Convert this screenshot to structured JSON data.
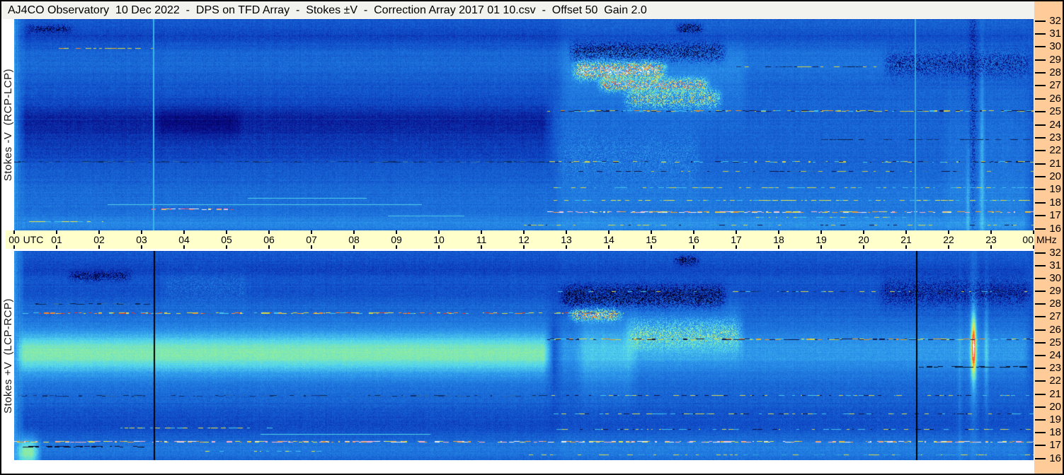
{
  "header": {
    "title": "AJ4CO Observatory  10 Dec 2022  -  DPS on TFD Array  -  Stokes ±V  -  Correction Array 2017 01 10.csv  -  Offset 50  Gain 2.0"
  },
  "axes": {
    "freq_unit": "MHz",
    "time_label": "UTC",
    "freq_ticks": [
      32,
      31,
      30,
      29,
      28,
      27,
      26,
      25,
      24,
      23,
      22,
      21,
      20,
      19,
      18,
      17,
      16
    ],
    "time_ticks": [
      {
        "label": "00",
        "t": 0
      },
      {
        "label": "UTC",
        "t": 0.45
      },
      {
        "label": "01",
        "t": 1
      },
      {
        "label": "02",
        "t": 2
      },
      {
        "label": "03",
        "t": 3
      },
      {
        "label": "04",
        "t": 4
      },
      {
        "label": "05",
        "t": 5
      },
      {
        "label": "06",
        "t": 6
      },
      {
        "label": "07",
        "t": 7
      },
      {
        "label": "08",
        "t": 8
      },
      {
        "label": "09",
        "t": 9
      },
      {
        "label": "10",
        "t": 10
      },
      {
        "label": "11",
        "t": 11
      },
      {
        "label": "12",
        "t": 12
      },
      {
        "label": "13",
        "t": 13
      },
      {
        "label": "14",
        "t": 14
      },
      {
        "label": "15",
        "t": 15
      },
      {
        "label": "16",
        "t": 16
      },
      {
        "label": "17",
        "t": 17
      },
      {
        "label": "18",
        "t": 18
      },
      {
        "label": "19",
        "t": 19
      },
      {
        "label": "20",
        "t": 20
      },
      {
        "label": "21",
        "t": 21
      },
      {
        "label": "22",
        "t": 22
      },
      {
        "label": "23",
        "t": 23
      },
      {
        "label": "00",
        "t": 24,
        "align": "right"
      }
    ]
  },
  "colors": {
    "time_band_bg": "#ffffcc",
    "freq_band_bg": "#ffcc99",
    "titlebar_bg": "#f2f2ee",
    "margin_bg": "#ffffff",
    "border": "#000000"
  },
  "chart_data": {
    "type": "heatmap",
    "title": "AJ4CO Observatory  10 Dec 2022  -  DPS on TFD Array  -  Stokes ±V  -  Correction Array 2017 01 10.csv  -  Offset 50  Gain 2.0",
    "observatory": "AJ4CO Observatory",
    "date": "10 Dec 2022",
    "instrument": "DPS on TFD Array",
    "quantity": "Stokes ±V",
    "correction_array": "Correction Array 2017 01 10.csv",
    "offset": 50,
    "gain": 2.0,
    "x_axis": {
      "label": "UTC",
      "range_hours": [
        0,
        24
      ],
      "tick_step": 1
    },
    "y_axis": {
      "label": "MHz",
      "range_mhz": [
        16,
        32
      ],
      "tick_step": 1
    },
    "colormap": [
      [
        0.0,
        0,
        0,
        40
      ],
      [
        0.08,
        8,
        8,
        130
      ],
      [
        0.18,
        14,
        70,
        195
      ],
      [
        0.25,
        25,
        105,
        215
      ],
      [
        0.35,
        45,
        150,
        235
      ],
      [
        0.47,
        85,
        215,
        235
      ],
      [
        0.6,
        150,
        240,
        150
      ],
      [
        0.7,
        235,
        235,
        85
      ],
      [
        0.8,
        255,
        165,
        45
      ],
      [
        0.9,
        255,
        60,
        40
      ],
      [
        1.0,
        255,
        255,
        255
      ]
    ],
    "panels": [
      {
        "ylabel": "Stokes -V  (RCP-LCP)",
        "seed": 7,
        "base": 0.215,
        "noise": 0.06,
        "bands": [
          {
            "f": 30.7,
            "s": 0.45,
            "a": -0.04,
            "t0": 0,
            "t1": 24
          },
          {
            "f": 29.0,
            "s": 0.9,
            "a": 0.035,
            "t0": 0,
            "t1": 24
          },
          {
            "f": 24.1,
            "s": 1.15,
            "a": -0.09,
            "t0": 0,
            "t1": 12.7
          },
          {
            "f": 24.2,
            "s": 0.85,
            "a": -0.045,
            "t0": 3.3,
            "t1": 5.4
          },
          {
            "f": 21.9,
            "s": 0.6,
            "a": -0.03,
            "t0": 0,
            "t1": 12.7
          },
          {
            "f": 17.9,
            "s": 1.3,
            "a": 0.05,
            "t0": 0,
            "t1": 24
          },
          {
            "f": 16.35,
            "s": 0.45,
            "a": 0.08,
            "t0": 0,
            "t1": 24
          },
          {
            "f": 24.0,
            "s": 15,
            "a": 0.025,
            "t0": 12.7,
            "t1": 24
          },
          {
            "f": 27.6,
            "s": 1.9,
            "a": 0.05,
            "t0": 12.8,
            "t1": 17.3
          },
          {
            "f": 21.0,
            "s": 3.2,
            "a": 0.03,
            "t0": 21.8,
            "t1": 24
          }
        ],
        "events": [
          {
            "f": 28.2,
            "s": 0.45,
            "a": 0.55,
            "t0": 13.1,
            "t1": 15.4,
            "sp": 1
          },
          {
            "f": 27.1,
            "s": 0.35,
            "a": 0.45,
            "t0": 13.7,
            "t1": 16.4,
            "sp": 1
          },
          {
            "f": 26.0,
            "s": 0.5,
            "a": 0.33,
            "t0": 14.3,
            "t1": 16.7,
            "sp": 1
          },
          {
            "f": 29.6,
            "s": 0.5,
            "a": -0.24,
            "t0": 13.0,
            "t1": 16.8,
            "sp": 1
          },
          {
            "f": 31.45,
            "s": 0.22,
            "a": -0.33,
            "t0": 15.55,
            "t1": 16.25,
            "sp": 1
          },
          {
            "f": 28.7,
            "s": 0.7,
            "a": -0.16,
            "t0": 20.4,
            "t1": 24,
            "sp": 1
          },
          {
            "f": 31.4,
            "s": 0.2,
            "a": -0.18,
            "t0": 0.2,
            "t1": 1.4,
            "sp": 1
          },
          {
            "f": 21.5,
            "s": 1.6,
            "a": 0.07,
            "t0": 12.7,
            "t1": 16.2,
            "sp": 1
          }
        ],
        "vstreaks": [
          {
            "t": 22.57,
            "f": 26,
            "fs": 9,
            "a": -0.13,
            "w": 3.5,
            "sp": 1
          },
          {
            "t": 22.78,
            "f": 21,
            "fs": 6,
            "a": 0.12,
            "w": 2.3,
            "sp": 0
          },
          {
            "t": 22.45,
            "f": 18,
            "fs": 3,
            "a": 0.1,
            "w": 1.8,
            "sp": 0
          }
        ],
        "vlines": [
          {
            "t": 3.283,
            "color": "#37b6e8",
            "w": 2
          },
          {
            "t": 21.22,
            "color": "#35a6de",
            "w": 2
          }
        ],
        "lines": [
          {
            "f": 29.9,
            "t0": 1.05,
            "t1": 3.27,
            "type": "speckle",
            "pal": [
              "#e8e44a",
              "#f0b020",
              "#d8d840",
              "#ff8820"
            ],
            "d": 0.85,
            "th": 1
          },
          {
            "f": 25.1,
            "t0": 12.55,
            "t1": 24,
            "type": "speckle",
            "pal": [
              "#d8d84a",
              "#0e0e3c",
              "#40c8f0",
              "#e89020",
              "#1a1a4a",
              "#c8c840"
            ],
            "d": 0.92,
            "th": 2
          },
          {
            "f": 21.2,
            "t0": 0,
            "t1": 12.6,
            "type": "speckle",
            "pal": [
              "#0a2a66",
              "#123a88",
              "#2a6ab0"
            ],
            "d": 0.75,
            "th": 2
          },
          {
            "f": 21.2,
            "t0": 12.6,
            "t1": 24,
            "type": "speckle",
            "pal": [
              "#d8d84a",
              "#101040",
              "#48c8e8",
              "#2a6ab0"
            ],
            "d": 0.7,
            "th": 2
          },
          {
            "f": 20.45,
            "t0": 12.6,
            "t1": 24,
            "type": "speckle",
            "pal": [
              "#c8c844",
              "#2a6ab0",
              "#101040"
            ],
            "d": 0.45,
            "th": 1
          },
          {
            "f": 19.2,
            "t0": 12.7,
            "t1": 24,
            "type": "speckle",
            "pal": [
              "#d8d84a",
              "#40c0e8"
            ],
            "d": 0.55,
            "th": 1
          },
          {
            "f": 18.35,
            "t0": 5.5,
            "t1": 8.3,
            "type": "solid",
            "color": "#4ad0e8",
            "th": 1
          },
          {
            "f": 18.2,
            "t0": 12.7,
            "t1": 24,
            "type": "speckle",
            "pal": [
              "#d8d84a",
              "#e8e850",
              "#40c0e8"
            ],
            "d": 0.6,
            "th": 1
          },
          {
            "f": 17.9,
            "t0": 2.2,
            "t1": 9.6,
            "type": "solid",
            "color": "#52d2ea",
            "th": 1
          },
          {
            "f": 17.55,
            "t0": 3.0,
            "t1": 5.3,
            "type": "speckle",
            "pal": [
              "#e8e84a",
              "#ff70b0",
              "#f0f0f0",
              "#e05050"
            ],
            "d": 0.75,
            "th": 2
          },
          {
            "f": 17.35,
            "t0": 12.55,
            "t1": 24,
            "type": "speckle",
            "pal": [
              "#f0f0f0",
              "#e8e84a",
              "#ffb0c0",
              "#f0a030"
            ],
            "d": 0.88,
            "th": 2
          },
          {
            "f": 17.0,
            "t0": 8.8,
            "t1": 10.6,
            "type": "solid",
            "color": "#4ac8e8",
            "th": 1
          },
          {
            "f": 16.9,
            "t0": 17.4,
            "t1": 21.0,
            "type": "speckle",
            "pal": [
              "#d8d84a",
              "#40c0e8"
            ],
            "d": 0.5,
            "th": 1
          },
          {
            "f": 16.55,
            "t0": 0.3,
            "t1": 2.1,
            "type": "speckle",
            "pal": [
              "#e8e84a",
              "#40c0e8"
            ],
            "d": 0.55,
            "th": 1
          },
          {
            "f": 16.3,
            "t0": 12.0,
            "t1": 24,
            "type": "speckle",
            "pal": [
              "#30a0d8",
              "#d8d84a",
              "#101040"
            ],
            "d": 0.5,
            "th": 1
          },
          {
            "f": 22.9,
            "t0": 19.0,
            "t1": 24,
            "type": "speckle",
            "pal": [
              "#0c1c4a",
              "#14306e"
            ],
            "d": 0.6,
            "th": 1
          },
          {
            "f": 28.5,
            "t0": 17.0,
            "t1": 20.3,
            "type": "speckle",
            "pal": [
              "#0e2050",
              "#163c80",
              "#d8d84a"
            ],
            "d": 0.5,
            "th": 1
          }
        ]
      },
      {
        "ylabel": "Stokes +V  (LCP-RCP)",
        "seed": 99,
        "base": 0.215,
        "noise": 0.06,
        "bands": [
          {
            "f": 30.7,
            "s": 0.45,
            "a": -0.04,
            "t0": 0,
            "t1": 24
          },
          {
            "f": 29.0,
            "s": 0.5,
            "a": -0.03,
            "t0": 0,
            "t1": 24
          },
          {
            "f": 24.2,
            "s": 1.05,
            "a": 0.27,
            "t0": 0,
            "t1": 12.7
          },
          {
            "f": 24.2,
            "s": 2.6,
            "a": 0.08,
            "t0": 0,
            "t1": 12.7
          },
          {
            "f": 24.3,
            "s": 1.35,
            "a": 0.12,
            "t0": 12.7,
            "t1": 24
          },
          {
            "f": 24.3,
            "s": 2.2,
            "a": 0.09,
            "t0": 13.2,
            "t1": 14.7
          },
          {
            "f": 25.9,
            "s": 1.5,
            "a": 0.06,
            "t0": 14.3,
            "t1": 17.2
          },
          {
            "f": 18.9,
            "s": 0.8,
            "a": -0.03,
            "t0": 0,
            "t1": 24
          },
          {
            "f": 16.8,
            "s": 0.6,
            "a": 0.07,
            "t0": 0,
            "t1": 24
          },
          {
            "f": 22.0,
            "s": 8,
            "a": 0.02,
            "t0": 12.7,
            "t1": 24
          }
        ],
        "events": [
          {
            "f": 28.6,
            "s": 0.6,
            "a": -0.24,
            "t0": 12.8,
            "t1": 16.8,
            "sp": 1
          },
          {
            "f": 27.2,
            "s": 0.3,
            "a": 0.5,
            "t0": 13.0,
            "t1": 14.35,
            "sp": 1
          },
          {
            "f": 25.7,
            "s": 0.8,
            "a": 0.2,
            "t0": 14.4,
            "t1": 17.2,
            "sp": 1
          },
          {
            "f": 31.4,
            "s": 0.22,
            "a": -0.3,
            "t0": 15.5,
            "t1": 16.15,
            "sp": 1
          },
          {
            "f": 16.4,
            "s": 0.8,
            "a": 0.3,
            "t0": 0,
            "t1": 0.65,
            "sp": 0
          },
          {
            "f": 28.9,
            "s": 0.8,
            "a": -0.12,
            "t0": 20.3,
            "t1": 24,
            "sp": 1
          },
          {
            "f": 30.2,
            "s": 0.25,
            "a": -0.17,
            "t0": 1.2,
            "t1": 2.8,
            "sp": 1
          },
          {
            "f": 29.3,
            "s": 0.9,
            "a": 0.05,
            "t0": 3.4,
            "t1": 5.6,
            "sp": 1
          }
        ],
        "vstreaks": [
          {
            "t": 22.58,
            "f": 24.7,
            "fs": 1.5,
            "a": 0.55,
            "w": 2.2,
            "sp": 0
          },
          {
            "t": 22.58,
            "f": 24.8,
            "fs": 4.5,
            "a": 0.13,
            "w": 4,
            "sp": 0
          },
          {
            "t": 22.88,
            "f": 24.5,
            "fs": 3.5,
            "a": 0.11,
            "w": 2,
            "sp": 0
          },
          {
            "t": 22.25,
            "f": 21,
            "fs": 6,
            "a": 0.05,
            "w": 2,
            "sp": 0
          }
        ],
        "vlines": [
          {
            "t": 3.3,
            "color": "#000000",
            "w": 2
          },
          {
            "t": 21.25,
            "color": "#000000",
            "w": 2
          }
        ],
        "lines": [
          {
            "f": 27.35,
            "t0": 0,
            "t1": 14.35,
            "type": "speckle",
            "pal": [
              "#e8e44a",
              "#ff8828",
              "#e83820",
              "#48c8e8",
              "#2a6ab0",
              "#d8d840"
            ],
            "d": 0.8,
            "th": 2
          },
          {
            "f": 28.05,
            "t0": 0.4,
            "t1": 3.2,
            "type": "speckle",
            "pal": [
              "#0e2858",
              "#0a2050",
              "#2f6cae"
            ],
            "d": 0.65,
            "th": 2
          },
          {
            "f": 25.3,
            "t0": 12.55,
            "t1": 24,
            "type": "speckle",
            "pal": [
              "#d8d84a",
              "#0e0e3c",
              "#40c8f0",
              "#e89020",
              "#1a1a4a"
            ],
            "d": 0.9,
            "th": 2
          },
          {
            "f": 23.2,
            "t0": 21.3,
            "t1": 23.9,
            "type": "speckle",
            "pal": [
              "#050f2a",
              "#0a1a3a"
            ],
            "d": 0.9,
            "th": 2
          },
          {
            "f": 20.9,
            "t0": 0,
            "t1": 12.6,
            "type": "speckle",
            "pal": [
              "#0a2a60",
              "#123a88",
              "#2a6ab0"
            ],
            "d": 0.6,
            "th": 2
          },
          {
            "f": 20.9,
            "t0": 12.6,
            "t1": 24,
            "type": "speckle",
            "pal": [
              "#d8d84a",
              "#101040",
              "#48c8e8"
            ],
            "d": 0.55,
            "th": 1
          },
          {
            "f": 19.5,
            "t0": 12.7,
            "t1": 24,
            "type": "speckle",
            "pal": [
              "#d8d84a",
              "#40c0e8",
              "#101040"
            ],
            "d": 0.55,
            "th": 1
          },
          {
            "f": 18.4,
            "t0": 2.5,
            "t1": 6.1,
            "type": "speckle",
            "pal": [
              "#e8e84a",
              "#50d0e8"
            ],
            "d": 0.5,
            "th": 1
          },
          {
            "f": 18.3,
            "t0": 12.7,
            "t1": 24,
            "type": "speckle",
            "pal": [
              "#d8d84a",
              "#101040",
              "#40c0e8"
            ],
            "d": 0.55,
            "th": 1
          },
          {
            "f": 17.9,
            "t0": 5.8,
            "t1": 9.8,
            "type": "solid",
            "color": "#4ecfe8",
            "th": 1
          },
          {
            "f": 17.35,
            "t0": 0,
            "t1": 24,
            "type": "speckle",
            "pal": [
              "#f0f0f0",
              "#e8e84a",
              "#f0a030",
              "#ffb0c0"
            ],
            "d": 0.8,
            "th": 2
          },
          {
            "f": 16.95,
            "t0": 0.2,
            "t1": 3.1,
            "type": "speckle",
            "pal": [
              "#05051a",
              "#101040"
            ],
            "d": 0.85,
            "th": 2
          },
          {
            "f": 16.6,
            "t0": 4.5,
            "t1": 7.6,
            "type": "speckle",
            "pal": [
              "#e8e84a",
              "#40c0e8"
            ],
            "d": 0.45,
            "th": 1
          },
          {
            "f": 16.3,
            "t0": 12.0,
            "t1": 24,
            "type": "speckle",
            "pal": [
              "#30a0d8",
              "#d8d84a"
            ],
            "d": 0.45,
            "th": 1
          },
          {
            "f": 29.0,
            "t0": 12.8,
            "t1": 24,
            "type": "speckle",
            "pal": [
              "#0e2050",
              "#163c80",
              "#48c8e8",
              "#d8d84a"
            ],
            "d": 0.45,
            "th": 1
          }
        ]
      }
    ]
  }
}
